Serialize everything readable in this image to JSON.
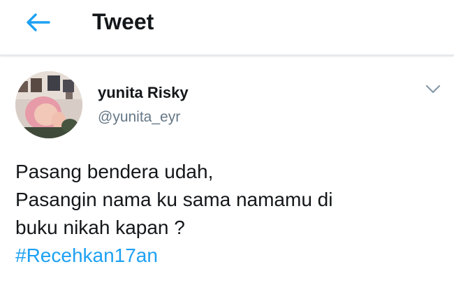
{
  "header": {
    "back_icon": "arrow-left-icon",
    "title": "Tweet",
    "accent_color": "#1da1f2"
  },
  "tweet": {
    "user": {
      "name": "yunita Risky",
      "handle": "@yunita_eyr",
      "avatar_icon": "profile-photo"
    },
    "menu_icon": "chevron-down-icon",
    "text_lines": [
      "Pasang bendera udah,",
      "Pasangin nama ku sama namamu di",
      "buku nikah kapan ?"
    ],
    "hashtag": "#Recehkan17an",
    "hashtag_color": "#1da1f2"
  }
}
